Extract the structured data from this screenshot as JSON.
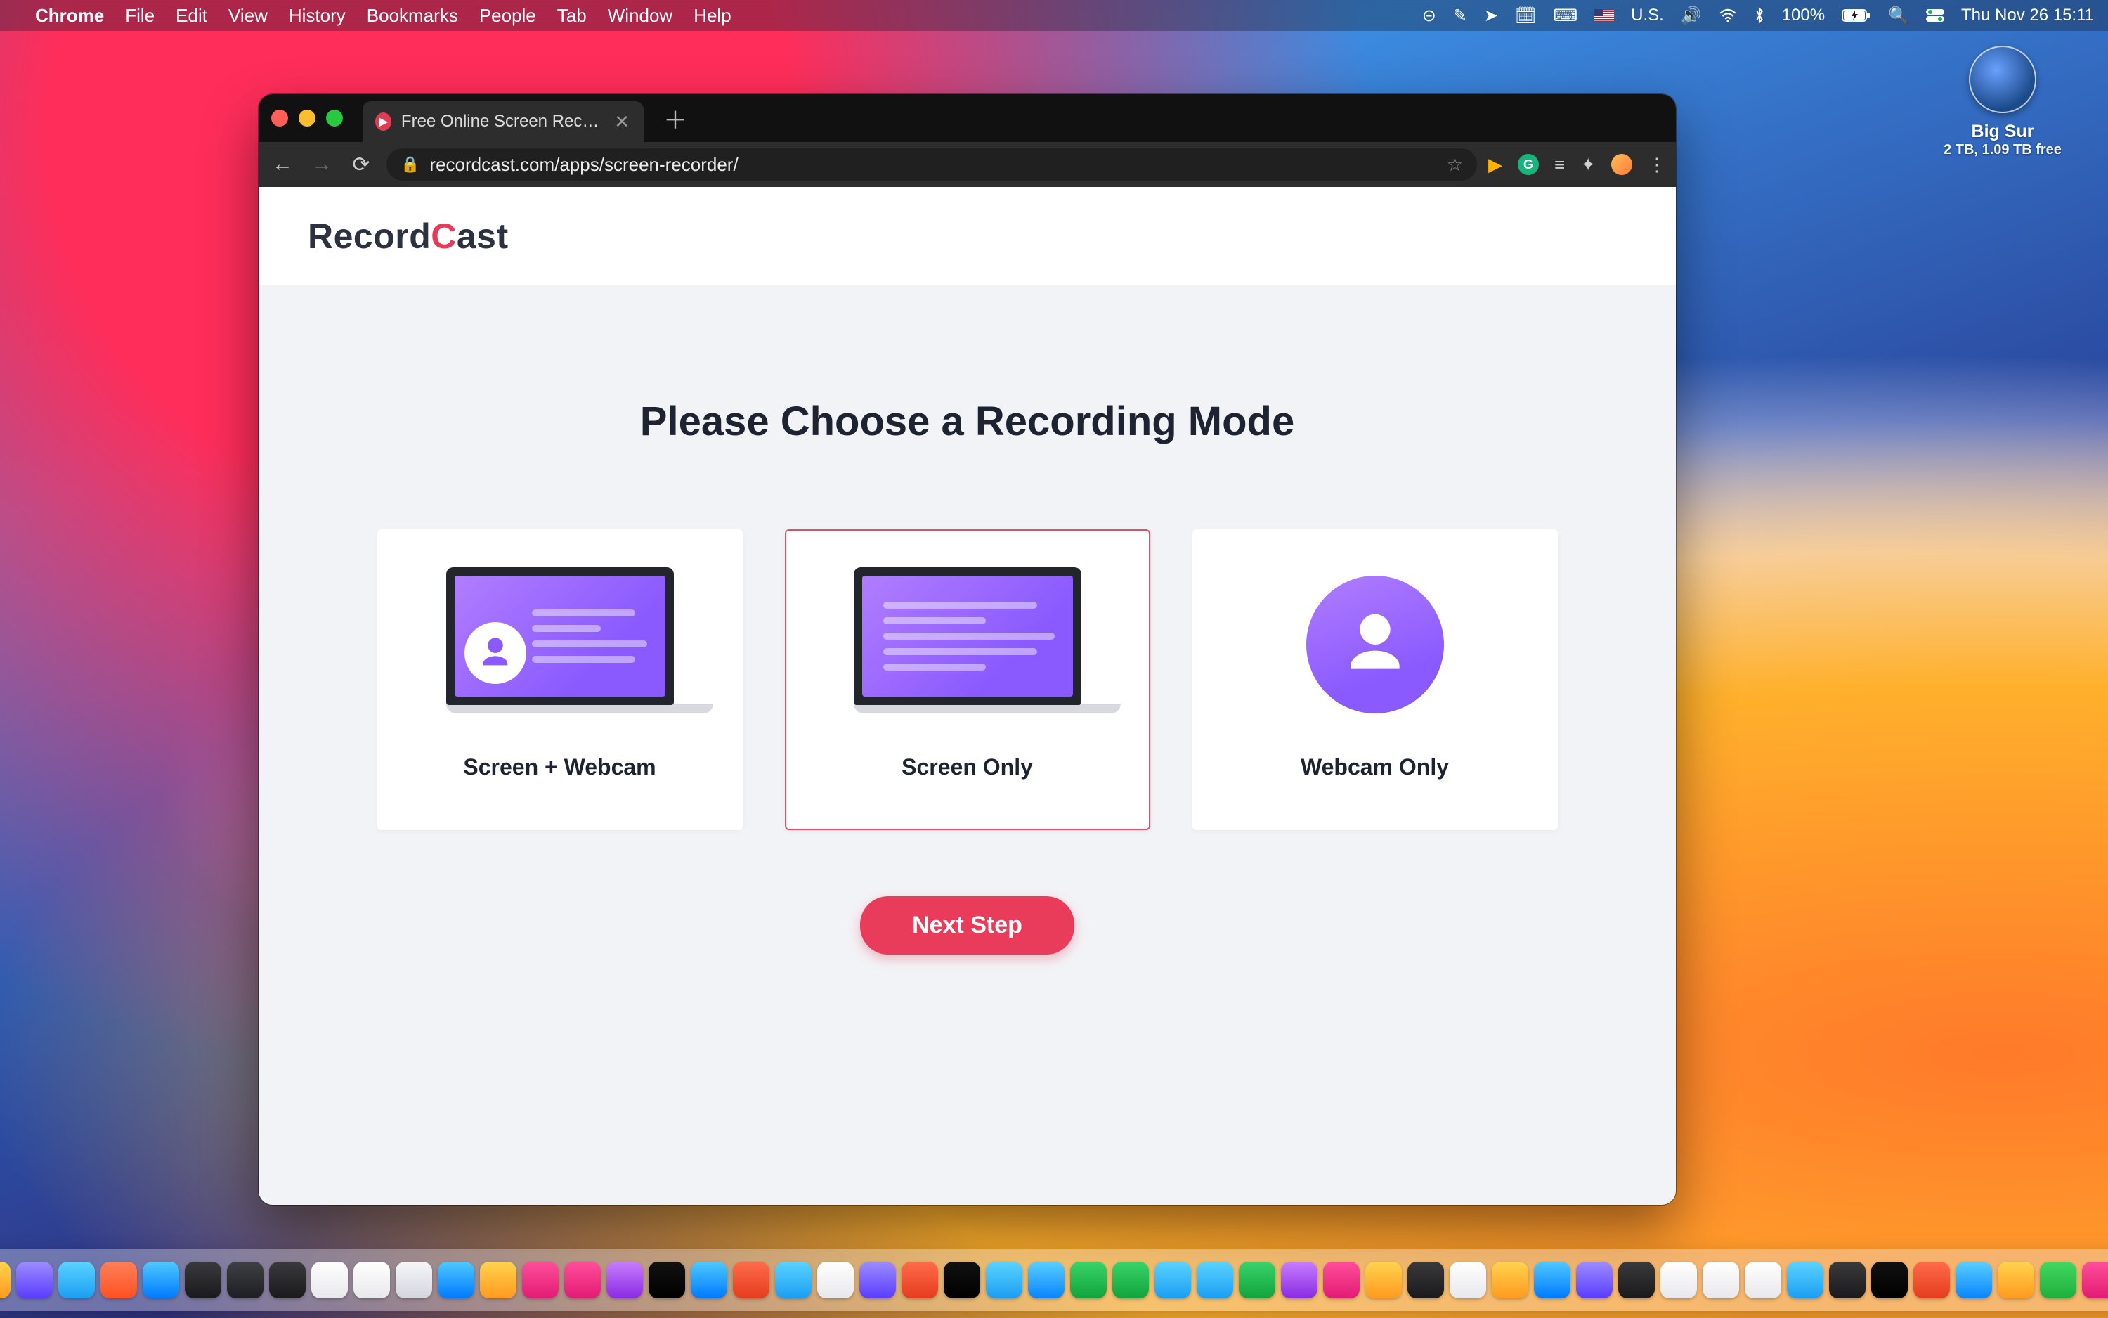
{
  "menubar": {
    "app": "Chrome",
    "menus": [
      "File",
      "Edit",
      "View",
      "History",
      "Bookmarks",
      "People",
      "Tab",
      "Window",
      "Help"
    ],
    "locale": "U.S.",
    "battery_pct": "100%",
    "charging_icon": "⚡︎",
    "datetime": "Thu Nov 26  15:11"
  },
  "desktop_widget": {
    "title": "Big Sur",
    "subtitle": "2 TB, 1.09 TB free"
  },
  "browser": {
    "tab_title": "Free Online Screen Recorder - ",
    "url_display": "recordcast.com/apps/screen-recorder/"
  },
  "page": {
    "brand_left": "Record",
    "brand_right": "ast",
    "heading": "Please Choose a Recording Mode",
    "cards": [
      {
        "label": "Screen + Webcam",
        "selected": false
      },
      {
        "label": "Screen Only",
        "selected": true
      },
      {
        "label": "Webcam Only",
        "selected": false
      }
    ],
    "next_button": "Next Step"
  },
  "dock": {
    "apps_left": [
      "finder",
      "home",
      "podcasts",
      "launchpad",
      "swift",
      "appstore",
      "calculator",
      "terminal",
      "activity",
      "xcode",
      "tips",
      "settings",
      "app1",
      "books",
      "news",
      "music",
      "podcasts2",
      "tv",
      "arcade",
      "navi",
      "app2",
      "chrome",
      "firefox",
      "brave",
      "opera",
      "safari",
      "app3",
      "whatsapp",
      "messages",
      "telegram",
      "skype",
      "facetime",
      "messenger",
      "instagram",
      "app4",
      "gimp",
      "app5",
      "app6",
      "app7",
      "app8",
      "inkscape",
      "notes",
      "reminders",
      "pages",
      "1password",
      "app9",
      "term2",
      "authy",
      "app10",
      "app11",
      "palette",
      "folder"
    ],
    "trash": "trash"
  }
}
